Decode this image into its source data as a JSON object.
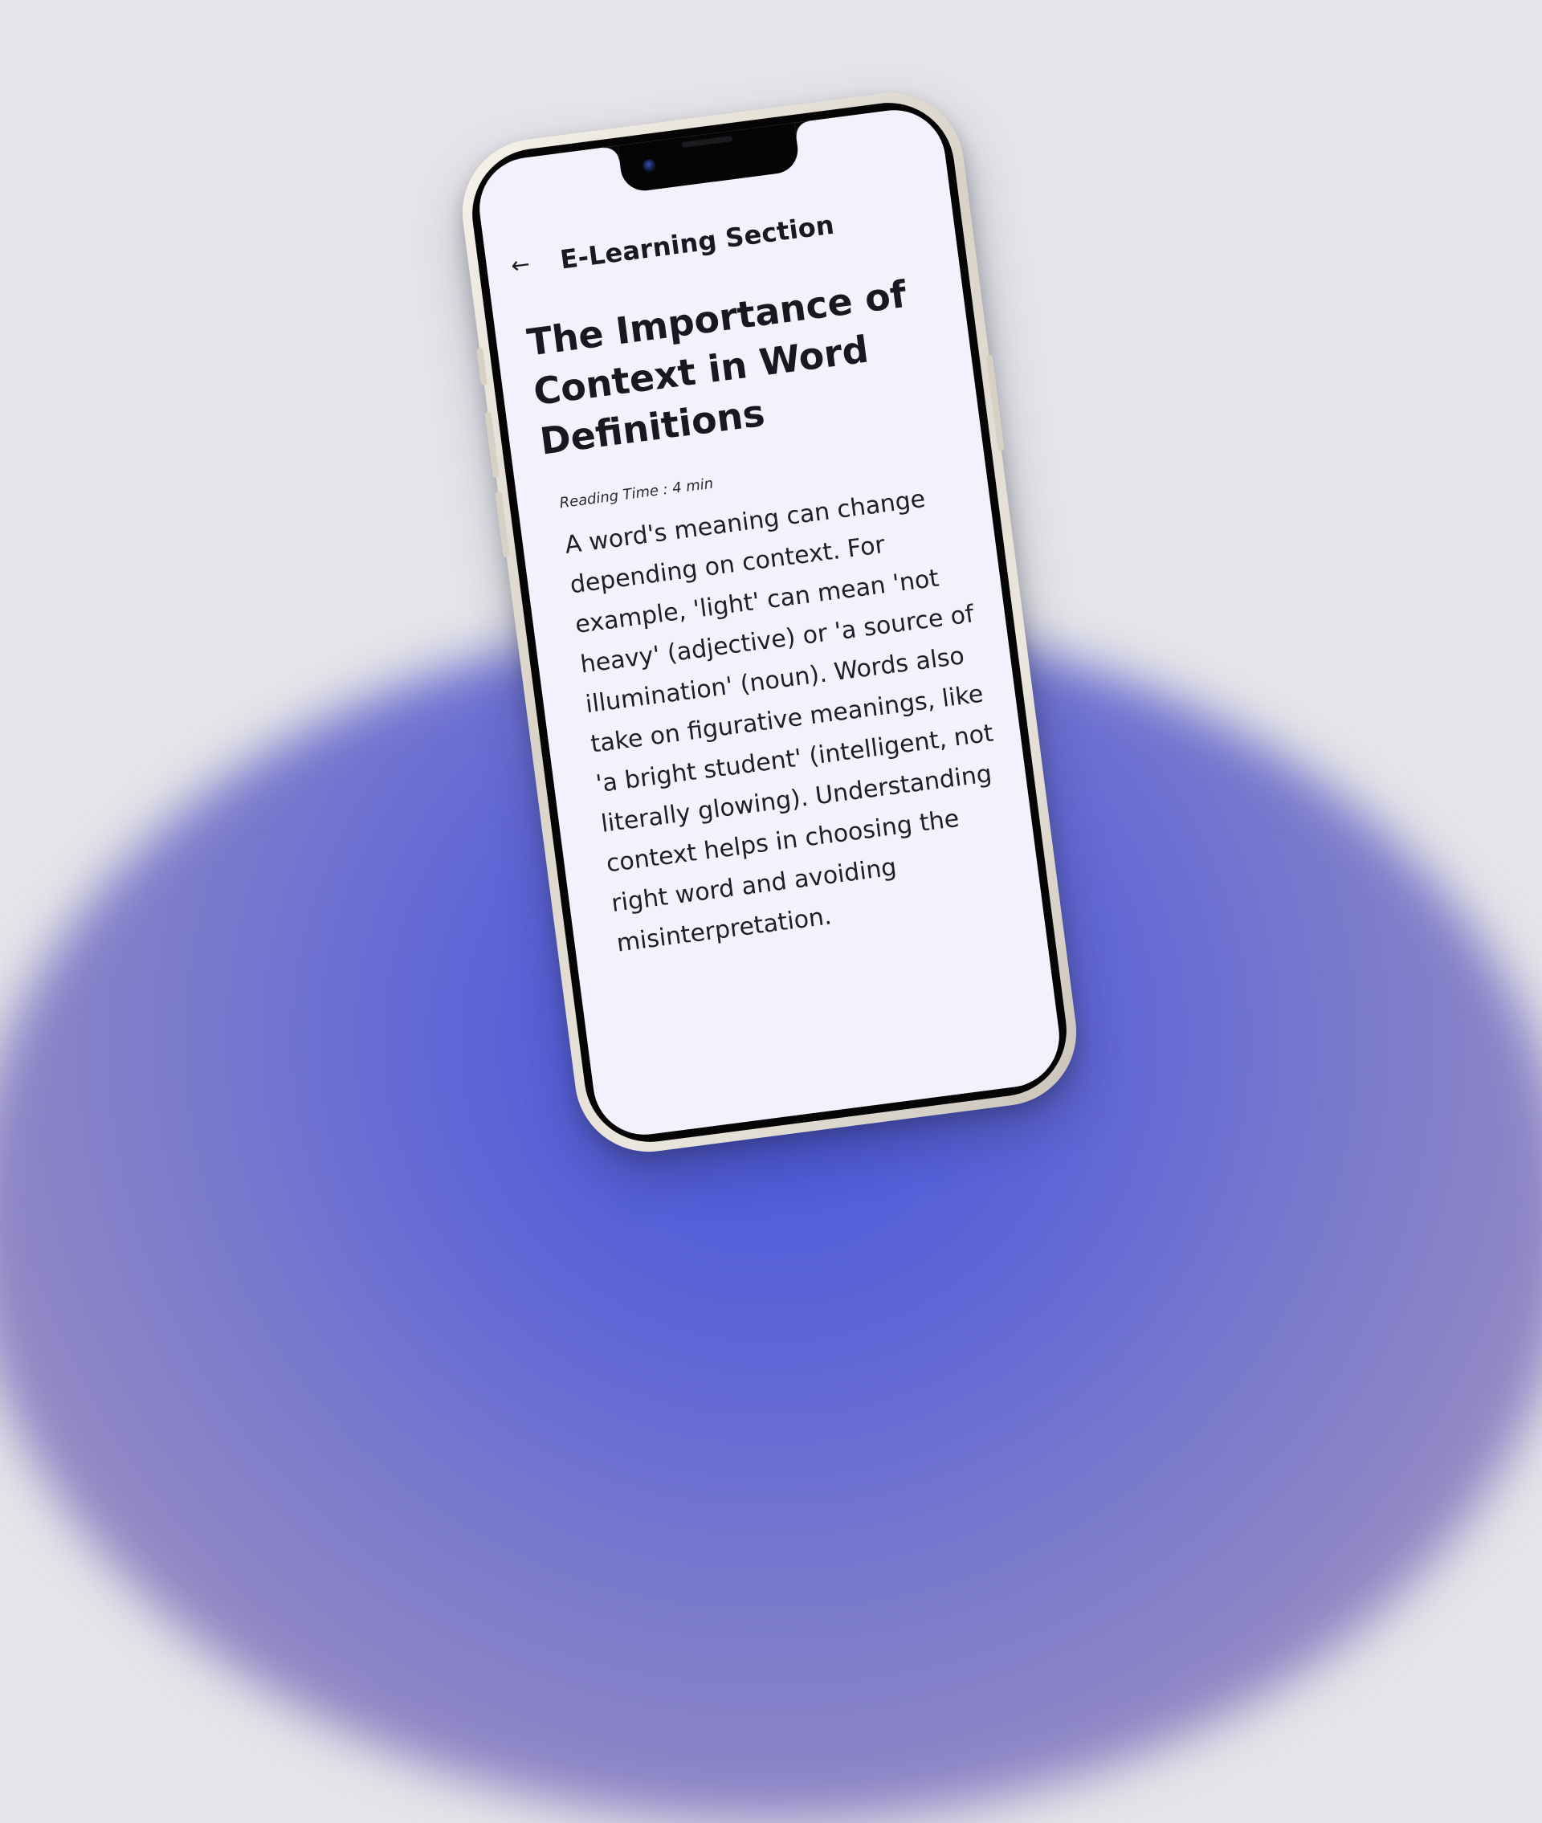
{
  "app_bar": {
    "back_icon": "arrow-left-icon",
    "title": "E-Learning Section"
  },
  "article": {
    "title": "The Importance of Context in Word Definitions",
    "reading_time": "Reading Time : 4 min",
    "body": "A word's meaning can change depending on context. For example, 'light' can mean 'not heavy' (adjective) or 'a source of illumination' (noun). Words also take on figurative meanings, like 'a bright student' (intelligent, not literally glowing). Understanding context helps in choosing the right word and avoiding misinterpretation."
  },
  "colors": {
    "screen_background": "#f2f1fd",
    "text": "#1e1e26",
    "backdrop_glow": "#4454de",
    "page_background": "#e5e5e9"
  }
}
